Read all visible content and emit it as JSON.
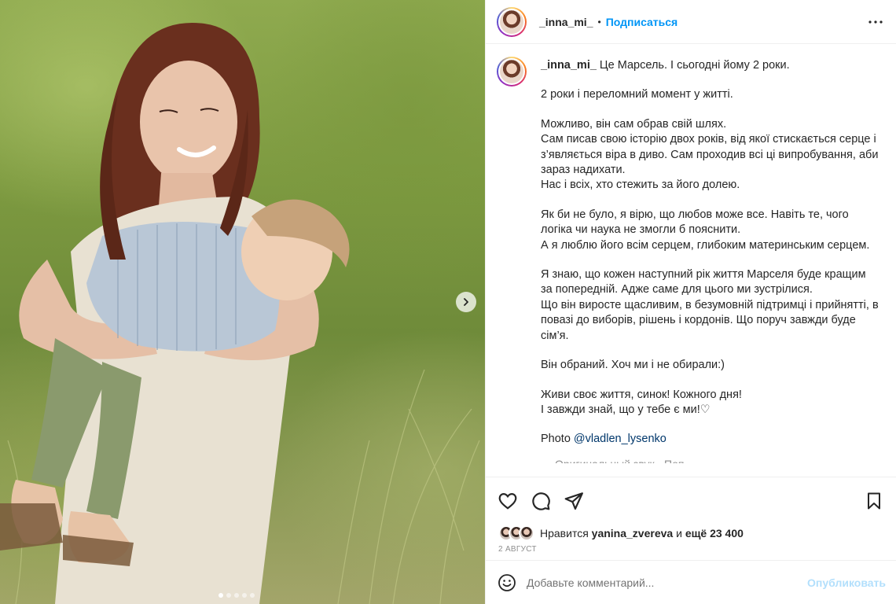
{
  "post": {
    "username": "_inna_mi_",
    "separator": "•",
    "follow_label": "Подписаться",
    "more_icon": "more-horizontal-icon"
  },
  "caption": {
    "username": "_inna_mi_",
    "first_line": "Це Марсель. І сьогодні йому 2 роки.",
    "paragraphs": [
      "2 роки і переломний момент у житті.",
      "Можливо, він сам обрав свій шлях.\nСам писав свою історію двох років, від якої стискається серце і з’являється віра в диво. Сам проходив всі ці випробування, аби зараз надихати.\nНас і всіх, хто стежить за його долею.",
      "Як би не було, я вірю, що любов може все. Навіть те, чого логіка чи наука не змогли б пояснити.\nА я люблю його всім серцем, глибоким материнським серцем.",
      "Я знаю, що кожен наступний рік життя Марселя буде кращим за попередній. Адже саме для цього ми зустрілися.\nЩо він виросте щасливим, в безумовній підтримці і прийнятті, в повазі до виборів, рішень і кордонів. Що поруч завжди буде сім’я.",
      "Він обраний. Хоч ми і не обирали:)",
      "Живи своє життя, синок! Кожного дня!\nІ завжди знай, що у тебе є ми!♡"
    ],
    "photo_prefix": "Photo ",
    "photo_credit": "@vladlen_lysenko",
    "cut_line": "Оригинальный звук · Поп"
  },
  "media": {
    "slides_total": 5,
    "active_slide": 1,
    "next_icon": "chevron-right-icon"
  },
  "actions": {
    "like_icon": "heart-icon",
    "comment_icon": "comment-icon",
    "share_icon": "send-icon",
    "save_icon": "bookmark-icon"
  },
  "likes": {
    "prefix": "Нравится ",
    "user": "yanina_zvereva",
    "middle": " и ",
    "count": "ещё 23 400"
  },
  "date": "2 АВГУСТ",
  "comment": {
    "emoji_icon": "smiley-icon",
    "placeholder": "Добавьте комментарий...",
    "publish_label": "Опубликовать"
  },
  "colors": {
    "accent": "#0095f6",
    "publish_disabled": "#b2dffc",
    "mention": "#00376b",
    "muted": "#8e8e8e"
  }
}
